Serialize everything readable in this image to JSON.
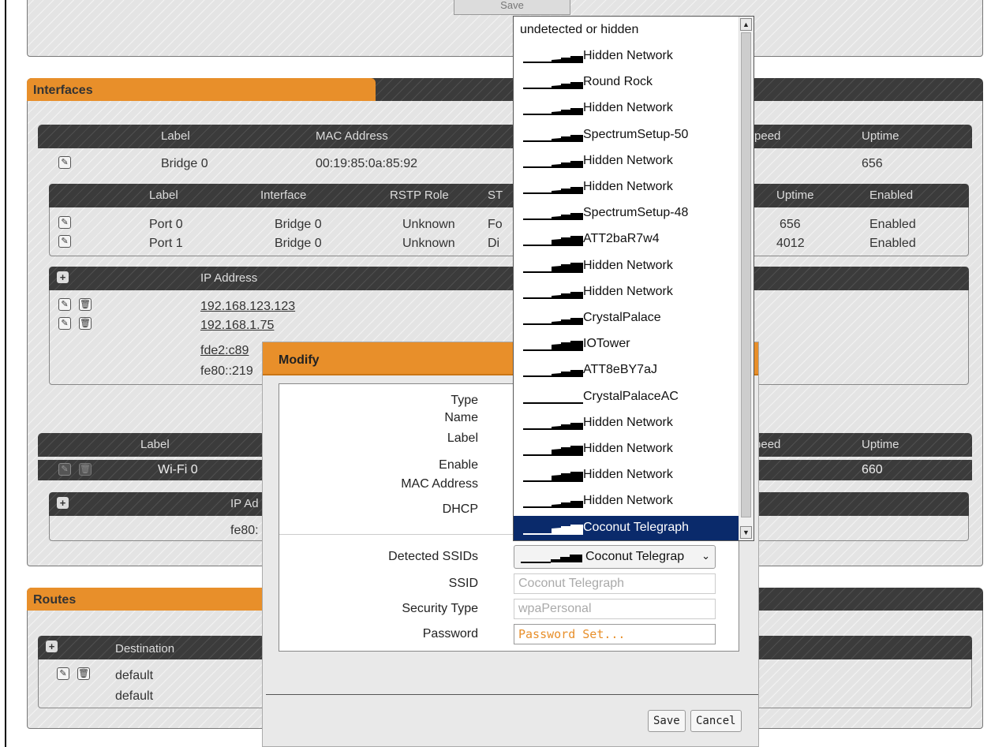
{
  "top_save": "Save",
  "interfaces": {
    "title": "Interfaces",
    "bridge_headers": [
      "Label",
      "MAC Address",
      "Speed",
      "Uptime"
    ],
    "bridge_row": {
      "label": "Bridge 0",
      "mac": "00:19:85:0a:85:92",
      "uptime": "656"
    },
    "port_headers": [
      "Label",
      "Interface",
      "RSTP Role",
      "ST",
      "Uptime",
      "Enabled"
    ],
    "ports": [
      {
        "label": "Port 0",
        "interface": "Bridge 0",
        "rstp": "Unknown",
        "st": "Fo",
        "uptime": "656",
        "enabled": "Enabled"
      },
      {
        "label": "Port 1",
        "interface": "Bridge 0",
        "rstp": "Unknown",
        "st": "Di",
        "uptime": "4012",
        "enabled": "Enabled"
      }
    ],
    "ip_header": "IP Address",
    "ips": [
      "192.168.123.123",
      "192.168.1.75",
      "fde2:c89",
      "fe80::219"
    ],
    "wifi_headers": [
      "Label",
      "Speed",
      "Uptime"
    ],
    "wifi_row": {
      "label": "Wi-Fi 0",
      "speed": "-",
      "uptime": "660"
    },
    "wifi_ip_header": "IP Ad",
    "wifi_ip": "fe80:"
  },
  "routes": {
    "title": "Routes",
    "header": "Destination",
    "rows": [
      "default",
      "default"
    ],
    "trailing": ")"
  },
  "modal": {
    "title": "Modify",
    "labels": {
      "type": "Type",
      "name": "Name",
      "label": "Label",
      "enable": "Enable",
      "mac": "MAC Address",
      "dhcp": "DHCP",
      "detected": "Detected SSIDs",
      "ssid": "SSID",
      "security": "Security Type",
      "password": "Password"
    },
    "detected_value": "Coconut Telegrap",
    "ssid_value": "Coconut Telegraph",
    "security_value": "wpaPersonal",
    "password_value": "Password Set...",
    "save": "Save",
    "cancel": "Cancel"
  },
  "dropdown": {
    "header": "undetected or hidden",
    "items": [
      {
        "name": "Hidden Network",
        "signal": 3
      },
      {
        "name": "Round Rock",
        "signal": 3
      },
      {
        "name": "Hidden Network",
        "signal": 3
      },
      {
        "name": "SpectrumSetup-50",
        "signal": 3
      },
      {
        "name": "Hidden Network",
        "signal": 3
      },
      {
        "name": "Hidden Network",
        "signal": 3
      },
      {
        "name": "SpectrumSetup-48",
        "signal": 3
      },
      {
        "name": "ATT2baR7w4",
        "signal": 4
      },
      {
        "name": "Hidden Network",
        "signal": 4
      },
      {
        "name": "Hidden Network",
        "signal": 3
      },
      {
        "name": "CrystalPalace",
        "signal": 3
      },
      {
        "name": "IOTower",
        "signal": 4
      },
      {
        "name": "ATT8eBY7aJ",
        "signal": 3
      },
      {
        "name": "CrystalPalaceAC",
        "signal": 1
      },
      {
        "name": "Hidden Network",
        "signal": 3
      },
      {
        "name": "Hidden Network",
        "signal": 4
      },
      {
        "name": "Hidden Network",
        "signal": 4
      },
      {
        "name": "Hidden Network",
        "signal": 3
      },
      {
        "name": "Coconut Telegraph",
        "signal": 4,
        "selected": true
      }
    ]
  },
  "icons": {
    "edit": "wrench-icon",
    "delete": "trash-icon",
    "add": "plus-icon"
  },
  "colors": {
    "accent": "#e88f2a",
    "selection": "#0a2a6b",
    "header_dark": "#3b3b3b"
  }
}
